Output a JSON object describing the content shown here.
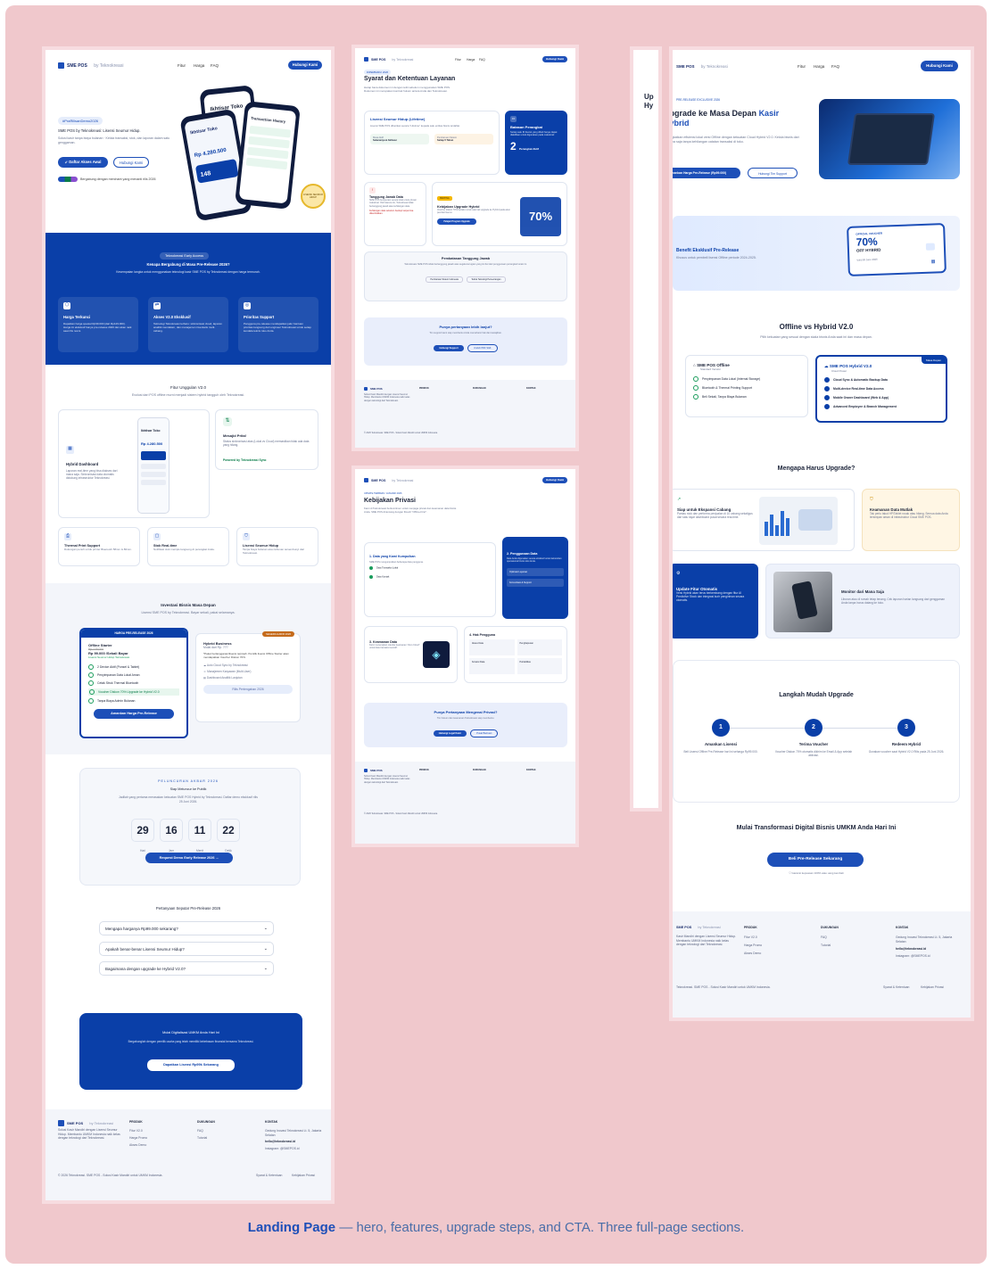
{
  "caption": {
    "bold": "Landing Page",
    "rest": "— hero, features, upgrade steps, and CTA. Three full-page sections."
  },
  "nav": {
    "brand": "SME POS",
    "brand_sub": "by Teknokreasi",
    "links": [
      "Fitur",
      "Harga",
      "FAQ"
    ],
    "cta": "Hubungi Kami"
  },
  "landing": {
    "hero_tag": "#PraRilisanDemo2026",
    "hero_text": "SME POS by Teknokreasi: Lisensi Seumur Hidup.",
    "hero_primary": "Daftar Akses Awal",
    "hero_secondary": "Hubungi Kami",
    "hero_trust": "Bergabung dengan merchant yang menanti rilis 2026",
    "phone_title": "Ikhtisar Toko",
    "phone_amount": "Rp 4.280.500",
    "phone_count": "148",
    "phone2_title": "Transaction History",
    "badge": "LISENSI SEUMUR HIDUP",
    "early_chip": "Teknokreasi Early Access",
    "early_title": "Kenapa Bergabung di Masa Pre-Release 2026?",
    "early_sub": "Kesempatan langka untuk menggunakan teknologi kasir SME POS by Teknokreasi dengan harga termurah.",
    "benefits": [
      {
        "title": "Harga Terkunci",
        "text": "Dapatkan harga spesial Rp99.000 (dari Rp129.000). Harga ini eksklusif hanya pre-release 2026 dan akan naik saat rilis resmi."
      },
      {
        "title": "Akses V2.0 Eksklusif",
        "text": "Teknologi Teknokreasi terbaru: sinkronisasi cloud, laporan analitik mendalam, dan manajemen inventaris multi-cabang."
      },
      {
        "title": "Prioritas Support",
        "text": "Pengguna pre-release mendapatkan jalur bantuan prioritas langsung dari engineer Teknokreasi untuk setiap kendala teknis toko Anda."
      }
    ],
    "features_title": "Fitur Unggulan V2.0",
    "features_sub": "Evolusi dari POS offline murni menjadi sistem hybrid tangguh oleh Teknokreasi.",
    "hybrid_title": "Hybrid Dashboard",
    "hybrid_text": "Laporan real-time yang bisa diakses dari mana saja. Sinkronisasi data otomatis didukung infrastruktur Teknokreasi.",
    "offline_title": "Mesajid Prita!",
    "offline_text": "Status sinkronisasi atas (Lokal vs Cloud) memastikan tidak ada data yang hilang.",
    "powered": "Powered by Teknokreasi Sync",
    "small_features": [
      {
        "title": "Thermal Print Support",
        "text": "Dukungan penuh untuk printer Bluetooth 58mm & 80mm."
      },
      {
        "title": "Stok Real-time",
        "text": "Notifikasi stok menipis langsung di perangkat Anda."
      },
      {
        "title": "Lisensi Seumur Hidup",
        "text": "Tanpa biaya bulanan atau tahunan tersembunyi dari Teknokreasi."
      }
    ],
    "invest_title": "Investasi Bisnis Masa Depan",
    "invest_sub": "Lisensi SME POS by Teknokreasi. Bayar sekali, pakai selamanya.",
    "price_head": "HARGA PRE-RELEASE 2026",
    "price_name": "Offline Starter",
    "price_old": "Rp 129,000",
    "price_new": "Rp 99.000 /Sekali Bayar",
    "price_note": "Lisensi Seumur Hidup Teknokreasi",
    "price_features": [
      "2 Device Aktif (Ponsel & Tablet)",
      "Penyimpanan Data Lokal Aman",
      "Cetak Struk Thermal Bluetooth",
      "Voucher Diskon 70% Upgrade ke Hybrid V2.0",
      "Tanpa Biaya Admin Bulanan"
    ],
    "price_cta": "Amankan Harga Pre-Release",
    "hybrid_plan_tag": "SEGERA HADIR 2026",
    "hybrid_plan_name": "Hybrid Business",
    "hybrid_plan_price": "Mulai dari Rp. ???",
    "hybrid_plan_note": "*Paket berlangganan/lisensi terpisah. Pemilik lisensi Offline Starter akan mendapatkan Voucher Diskon 70%.",
    "hybrid_plan_features": [
      "Auto Cloud Sync by Teknokreasi",
      "Manajemen Karyawan (Multi-User)",
      "Dashboard Analitik Lanjutan"
    ],
    "hybrid_plan_cta": "Rilis Pertengahan 2026",
    "launch_chip": "PELUNCURAN AKBAR 2026",
    "launch_title": "Siap Meluncur ke Publik",
    "launch_text": "Jadilah yang pertama merasakan kekuatan SME POS Hybrid by Teknokreasi. Daftar demo eksklusif rilis 25 Juni 2026.",
    "countdown": [
      {
        "value": "29",
        "label": "Hari"
      },
      {
        "value": "16",
        "label": "Jam"
      },
      {
        "value": "11",
        "label": "Menit"
      },
      {
        "value": "22",
        "label": "Detik"
      }
    ],
    "launch_cta": "Request Demo Early Release 2026 →",
    "faq_title": "Pertanyaan Seputar Pre-Release 2026",
    "faqs": [
      "Mengapa harganya Rp99.000 sekarang?",
      "Apakah benar-benar Lisensi Seumur Hidup?",
      "Bagaimana dengan upgrade ke Hybrid V2.0?"
    ],
    "cta_title": "Mulai Digitalisasi UMKM Anda Hari Ini",
    "cta_text": "Bergabunglah dengan pemilik usaha yang telah memiliki kebebasan finansial bersama Teknokreasi.",
    "cta_button": "Dapatkan Lisensi Rp99k Sekarang"
  },
  "footer": {
    "desc": "Solusi Kasir Mandiri dengan Lisensi Seumur Hidup. Membantu UMKM Indonesia naik kelas dengan teknologi dari Teknokreasi.",
    "col1": "PRODUK",
    "col1_items": [
      "Fitur V2.0",
      "Harga Promo",
      "Akses Demo"
    ],
    "col2": "DUKUNGAN",
    "col2_items": [
      "FAQ",
      "Tutorial"
    ],
    "col3": "KONTAK",
    "col3_items": [
      "Gedung Inovasi Teknokreasi Lt. 5, Jakarta Selatan",
      "hello@teknokreasi.id",
      "Instagram: @SMEPOS.id"
    ],
    "copyright": "© 2026 Teknokreasi. SME POS - Solusi Kasir Mandiri untuk UMKM Indonesia.",
    "legal": [
      "Syarat & Ketentuan",
      "Kebijakan Privasi"
    ]
  },
  "terms": {
    "chip": "DIPERBARUI 2026",
    "title": "Syarat dan Ketentuan Layanan",
    "intro": "Harap baca dokumen ini dengan teliti sebelum menggunakan SME POS. Dokumen ini merupakan kontrak hukum antara Anda dan Teknokreasi.",
    "license_title": "Lisensi Seumur Hidup (Lifetime)",
    "license_text": "Lisensi SME POS diberikan secara \"Lifetime\" kepada satu entitas bisnis terdaftar.",
    "license_left_label": "Masa Aktif",
    "license_left_value": "Selamanya & Aktivasi",
    "license_right_label": "Pembaruan Sistem",
    "license_right_value": "Setiap 5 Tahun",
    "limit_title": "Batasan Perangkat",
    "limit_text": "Setiap satu ID lisensi yang dibeli hanya dapat diaktifkan untuk digunakan pada maksimal:",
    "limit_value": "2",
    "limit_unit": "Perangkat Aktif",
    "resp_title": "Tanggung Jawab Data",
    "resp_text": "SME POS beroperasi secara lokal untuk privasi maksimal. Oleh karena itu, Teknokreasi tidak bertanggung jawab atas kehilangan data.",
    "resp_warn": "Kehilangan data sebelum backup tanpa bisa dikembalikan.",
    "hybrid_chip": "PENTING",
    "hybrid_title": "Kebijakan Upgrade Hybrid",
    "hybrid_text": "Voucher diskon 70% berlaku untuk satu kali upgrade ke Hybrid pada akun pembeli lisensi.",
    "hybrid_cta": "Pelajari Program Upgrade",
    "hybrid_big": "70%",
    "limits_title": "Pembatasan Tanggung Jawab",
    "limits_text": "Teknokreasi SME POS tidak bertanggung jawab atas segala kerugian yang timbul dari penggunaan perangkat lunak ini.",
    "limits_b1": "Pembaruan Sistem Indonesia",
    "limits_b2": "Teknis Teknologi Perseorangan",
    "help_title": "Punya pertanyaan lebih lanjut?",
    "help_text": "Tim support kami siap membantu Anda memahami hak dan kewajiban.",
    "help_b1": "Hubungi Support",
    "help_b2": "Unduh PDF S&K"
  },
  "privacy": {
    "chip": "UPDATE TERBARU: JANUARI 2026",
    "title": "Kebijakan Privasi",
    "intro": "Kami di Teknokreasi berkomitmen untuk menjaga privasi dan keamanan data bisnis Anda. SME POS dirancang dengan filosofi \"Offline-First\".",
    "s1_title": "1. Data yang Kami Kumpulkan",
    "s1_text": "SME POS mengumpulkan beberapa data pengguna.",
    "s1_items": [
      "Data Transaksi Lokal",
      "Data Kontak"
    ],
    "s2_title": "2. Penggunaan Data",
    "s2_text": "Data Anda digunakan secara eksklusif untuk kebutuhan operasional bisnis toko Anda.",
    "s2_items": [
      "Optimasi Layanan",
      "Komunikasi & Support"
    ],
    "s3_title": "3. Keamanan Data",
    "s3_text": "Kami menerapkan standar keamanan \"Zero Cloud\" untuk data transaksi sensitif.",
    "s4_title": "4. Hak Pengguna",
    "s4_items": [
      "Akses Data",
      "Penghapusan",
      "Koreksi Data",
      "Portabilitas"
    ],
    "help_title": "Punya Pertanyaan Mengenai Privasi?",
    "help_text": "Tim hukum dan keamanan Teknokreasi siap membantu.",
    "help_b1": "Hubungi Legal Kami",
    "help_b2": "Pusat Bantuan"
  },
  "upgrade": {
    "chip": "PRE-RELEASE EXCLUSIVE 2026",
    "title_part": "Upgrade ke Masa Depan",
    "title_accent": "Kasir Hybrid",
    "title_cut1": "Up",
    "title_cut2": "Hy",
    "text": "Tingkatkan efisiensi lokal versi Offline dengan kekuatan Cloud Hybrid V2.0. Kelola bisnis dari mana saja tanpa kehilangan catatan transaksi di toko.",
    "cta1": "Amankan Harga Pre-Release (Rp99.000)",
    "cta2": "Hubungi Tim Support",
    "benefit_title": "Benefit Eksklusif Pre-Release",
    "benefit_text": "Khusus untuk pembeli lisensi Offline periode 2024-2025.",
    "voucher_tag": "OFFICIAL VOUCHER",
    "voucher_value": "70%",
    "voucher_label": "OFF HYBRID",
    "voucher_date": "Valid till June 2026",
    "compare_title": "Offline vs Hybrid V2.0",
    "compare_sub": "Pilih kekuatan yang sesuai dengan skala bisnis Anda saat ini dan masa depan.",
    "offline_name": "SME POS Offline",
    "offline_sub": "Standard Version",
    "offline_items": [
      "Penyimpanan Data Lokal (Internal Storage)",
      "Bluetooth & Thermal Printing Support",
      "Beli Sekali, Tanpa Biaya Bulanan"
    ],
    "hybrid_name": "SME POS Hybrid V2.0",
    "hybrid_sub": "Cloud Power",
    "hybrid_tag": "Masa Depan",
    "hybrid_items": [
      "Cloud Sync & Automatic Backup Data",
      "Multi-device Real-time Data Access",
      "Mobile Owner Dashboard (Web & App)",
      "Advanced Employee & Branch Management"
    ],
    "why_title": "Mengapa Harus Upgrade?",
    "why1_title": "Siap untuk Ekspansi Cabang",
    "why1_text": "Pantau stok dan performa penjualan di 10 cabang sekaligus dari satu layar dashboard pusat secara real-time.",
    "why2_title": "Keamanan Data Mutlak",
    "why2_text": "Tak perlu takut HP/Tablet rusak atau hilang. Semua data Anda tersimpan aman di infrastruktur Cloud SME POS.",
    "why3_title": "Update Fitur Otomatis",
    "why3_text": "Versi Hybrid akan terus berkembang dengan fitur AI Predictive Stock dan integrasi kurir pengiriman secara otomatis.",
    "why4_title": "Monitor dari Mana Saja",
    "why4_text": "Liburan atau di rumah tetap tenang. Cek laporan harian langsung dari genggaman Anda tanpa harus datang ke toko.",
    "steps_title": "Langkah Mudah Upgrade",
    "steps": [
      {
        "n": "1",
        "title": "Amankan Lisensi",
        "text": "Beli Lisensi Offline Pre-Release hari ini seharga Rp99.000."
      },
      {
        "n": "2",
        "title": "Terima Voucher",
        "text": "Voucher Diskon 70% otomatis dikirim ke Email & App setelah aktivasi."
      },
      {
        "n": "3",
        "title": "Redeem Hybrid",
        "text": "Gunakan voucher saat Hybrid V2.0 Rilis pada 25 Juni 2026."
      }
    ],
    "final_title": "Mulai Transformasi Digital Bisnis UMKM Anda Hari Ini",
    "final_cta": "Beli Pre-Release Sekarang",
    "final_note": "Garansi kepuasan 100% atau uang kembali",
    "foot_desc": "Kasir Mandiri dengan Lisensi Seumur Hidup. Membantu UMKM Indonesia naik kelas dengan teknologi dari Teknokreasi.",
    "copyright": "Teknokreasi. SME POS - Solusi Kasir Mandiri untuk UMKM Indonesia."
  }
}
